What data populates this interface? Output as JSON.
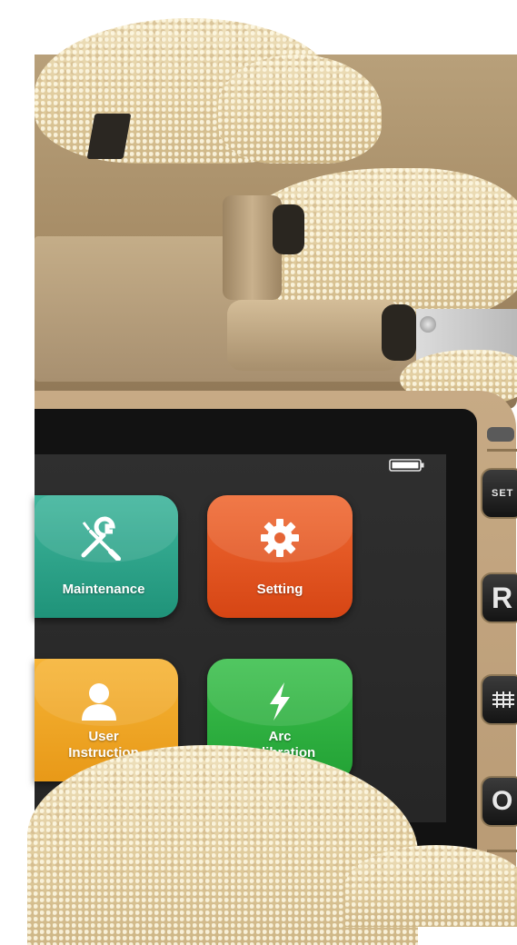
{
  "tiles": {
    "maintenance": {
      "label": "Maintenance",
      "color": "#2aa386"
    },
    "setting": {
      "label": "Setting",
      "color": "#e25420"
    },
    "user_instruction": {
      "label": "User\nInstruction",
      "color": "#f0a624"
    },
    "arc_calibration": {
      "label": "Arc\nCalibration",
      "color": "#2fb041"
    }
  },
  "side_buttons": {
    "set": "SET",
    "r": "R",
    "heat_icon": "heater-icon",
    "o": "O"
  },
  "status": {
    "battery_icon": "battery-icon"
  },
  "device_color": "#b89a74"
}
